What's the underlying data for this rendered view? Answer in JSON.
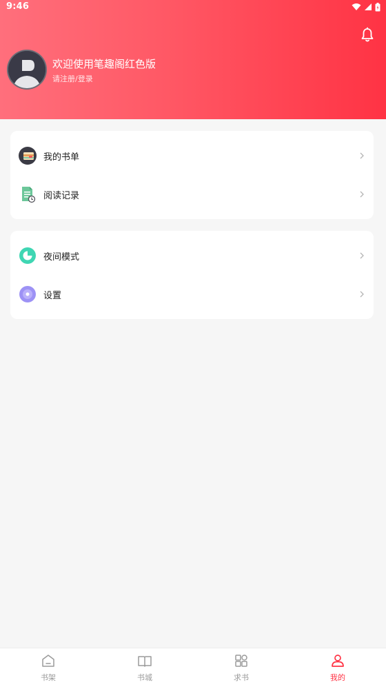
{
  "status_bar": {
    "time": "9:46"
  },
  "header": {
    "welcome_text": "欢迎使用笔趣阁红色版",
    "login_hint": "请注册/登录",
    "accent_color": "#ff3344"
  },
  "menu_group_1": [
    {
      "label": "我的书单",
      "icon": "booklist-icon"
    },
    {
      "label": "阅读记录",
      "icon": "reading-record-icon"
    }
  ],
  "menu_group_2": [
    {
      "label": "夜间模式",
      "icon": "night-mode-icon"
    },
    {
      "label": "设置",
      "icon": "settings-icon"
    }
  ],
  "bottom_nav": [
    {
      "label": "书架",
      "icon": "bookshelf-icon",
      "active": false
    },
    {
      "label": "书城",
      "icon": "bookstore-icon",
      "active": false
    },
    {
      "label": "求书",
      "icon": "request-book-icon",
      "active": false
    },
    {
      "label": "我的",
      "icon": "profile-icon",
      "active": true
    }
  ]
}
